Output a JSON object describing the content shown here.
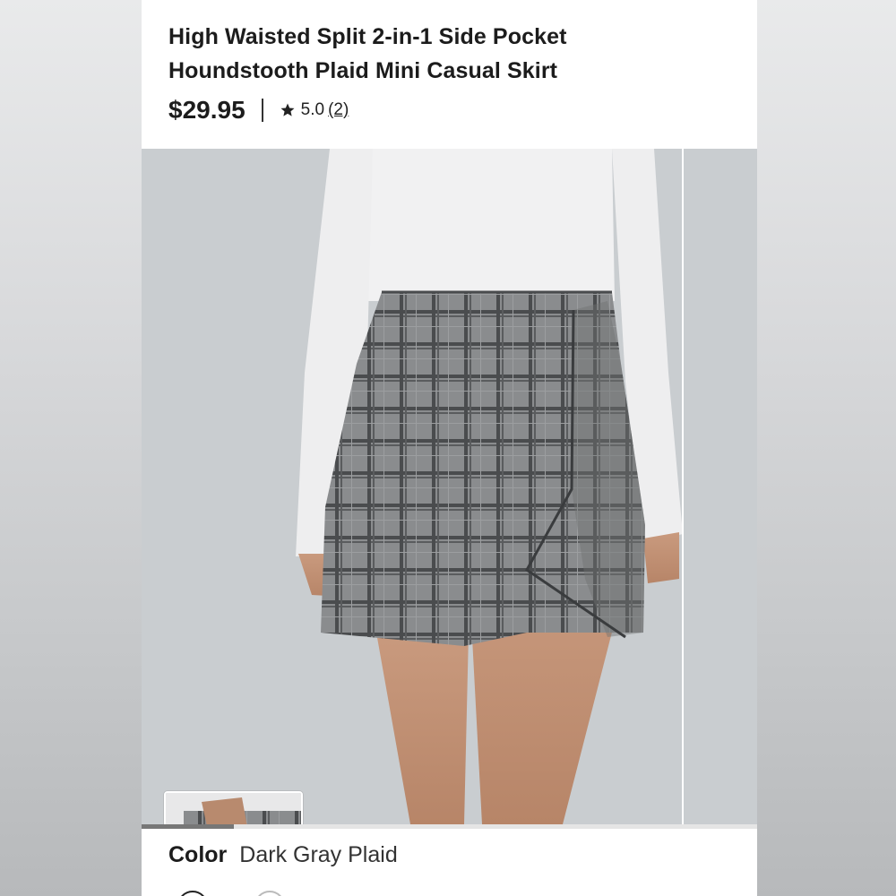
{
  "product": {
    "title_line1": "High Waisted Split 2-in-1 Side Pocket",
    "title_line2": "Houndstooth Plaid Mini Casual Skirt",
    "price": "$29.95",
    "rating": "5.0",
    "review_count": "(2)"
  },
  "gallery": {
    "main_image": "houndstooth-plaid-skirt-photo",
    "thumbnail_image": "black-inner-shorts-pocket-photo",
    "progress": 0.15
  },
  "options": {
    "color_label": "Color",
    "color_value": "Dark Gray Plaid"
  },
  "icons": {
    "rating": "star-icon"
  },
  "colors": {
    "background": "#ffffff",
    "photo_bg": "#c9cdd0",
    "text": "#1c1c1c",
    "progress": "#777777"
  }
}
